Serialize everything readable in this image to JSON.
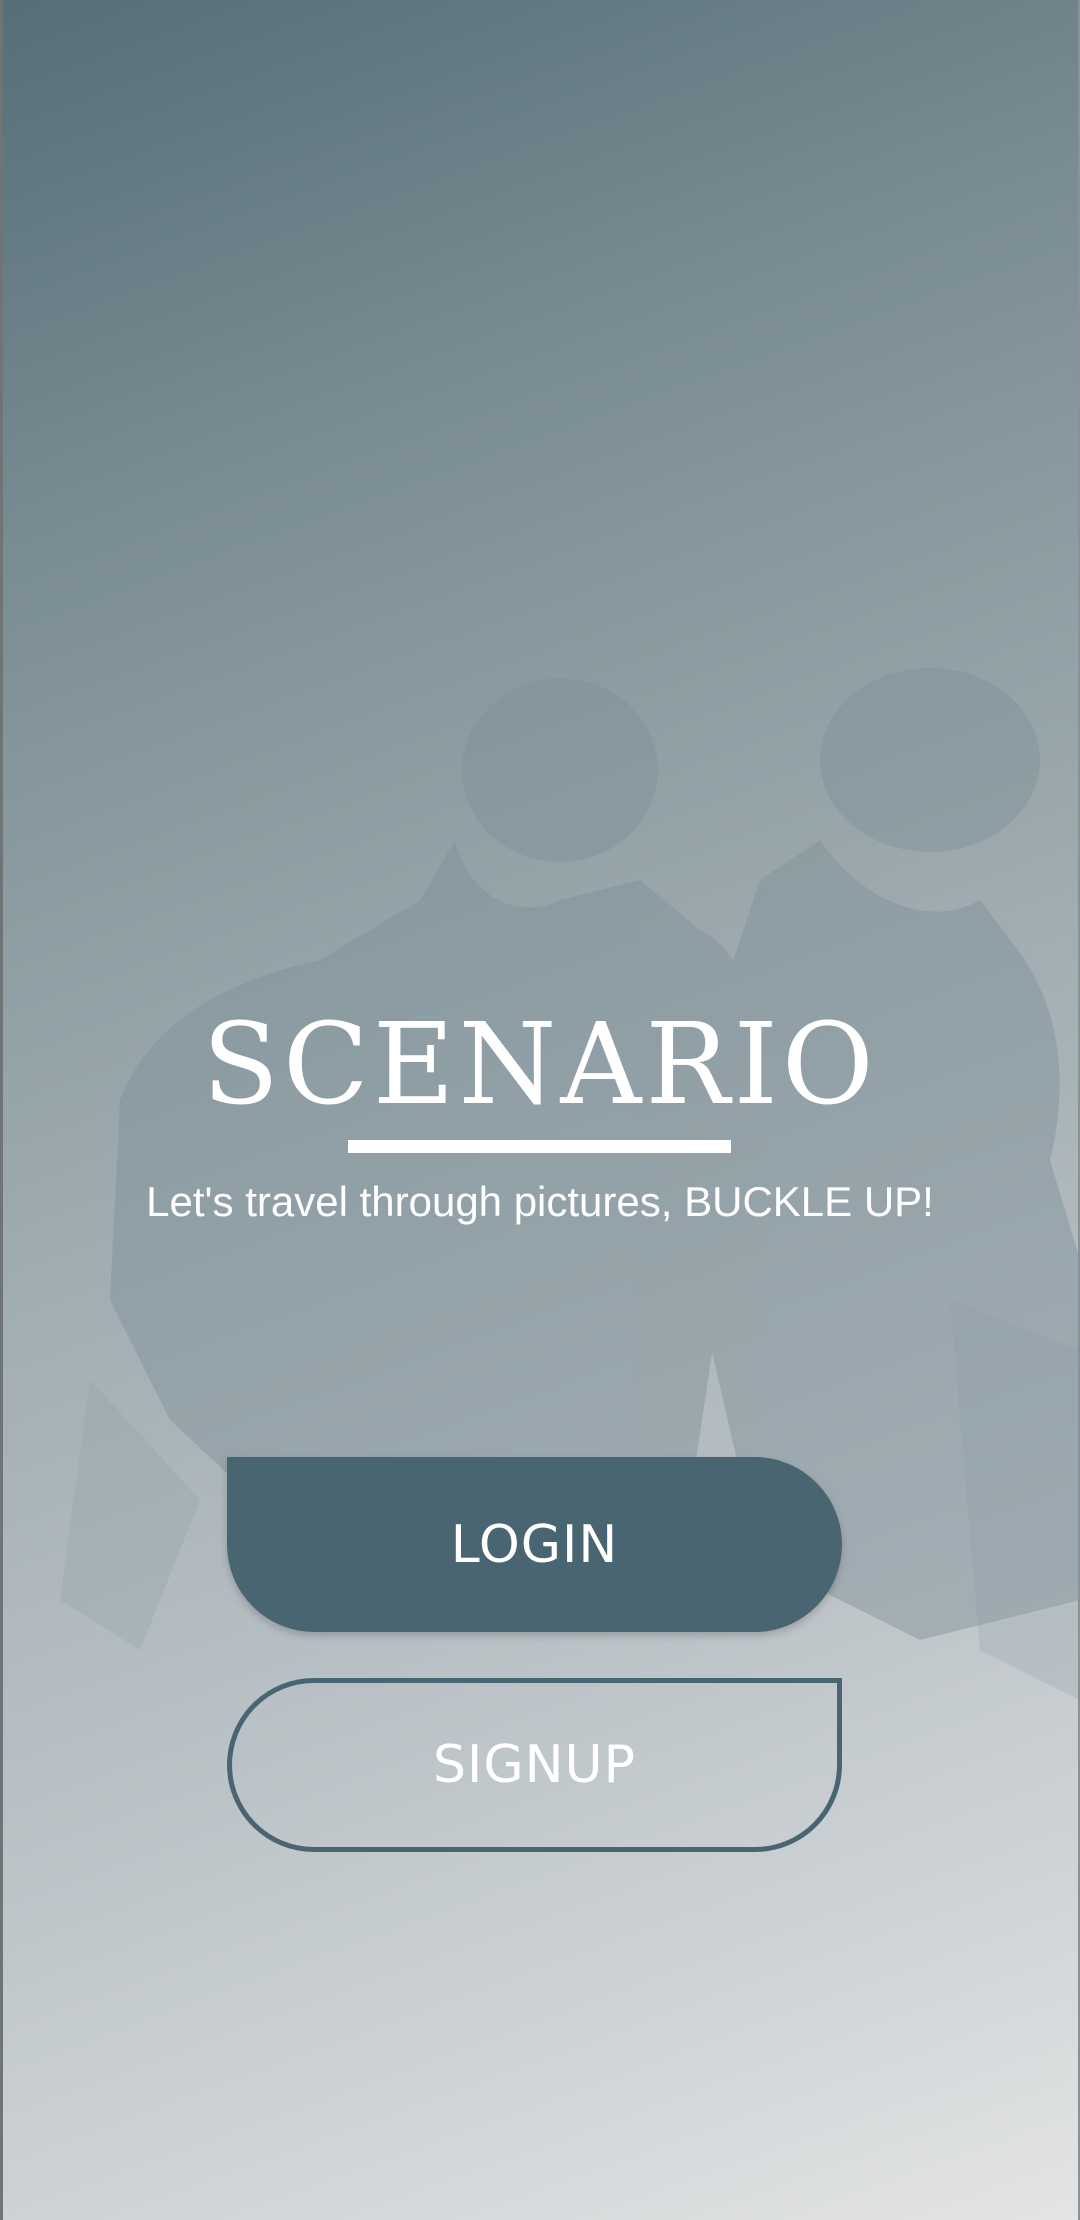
{
  "app": {
    "title": "SCENARIO",
    "tagline": "Let's travel through pictures, BUCKLE UP!"
  },
  "actions": {
    "login_label": "LOGIN",
    "signup_label": "SIGNUP"
  },
  "colors": {
    "primary": "#4a6572",
    "text": "#ffffff",
    "background_top": "#566e78",
    "background_bottom": "#e3e4e4"
  }
}
